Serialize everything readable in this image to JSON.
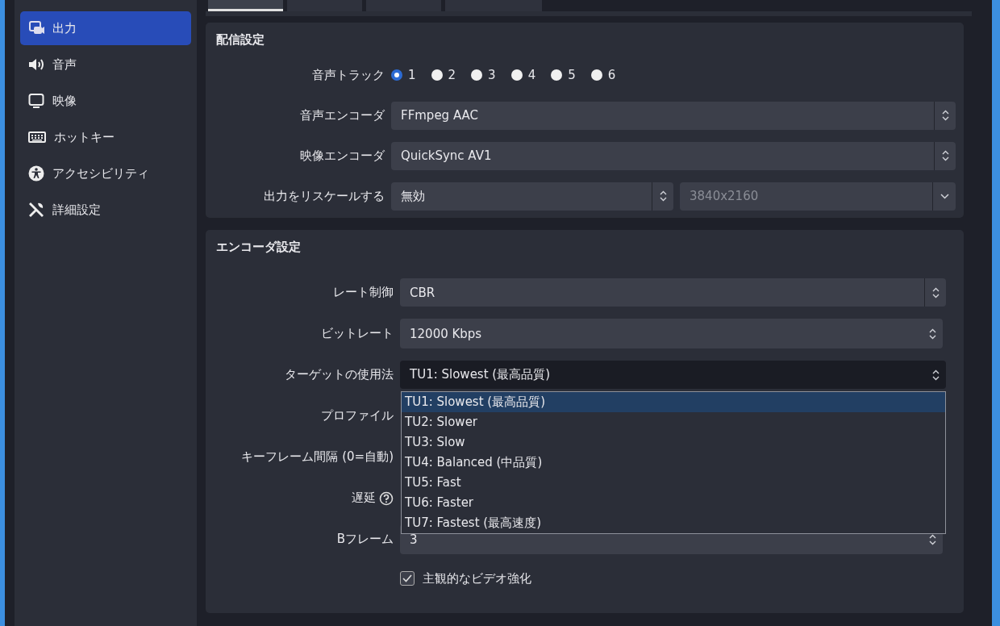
{
  "tabs": [
    {
      "selected": true
    },
    {
      "selected": false
    },
    {
      "selected": false
    },
    {
      "selected": false
    }
  ],
  "sidebar": {
    "items": [
      {
        "kind": "output",
        "label": "出力",
        "selected": true
      },
      {
        "kind": "audio",
        "label": "音声",
        "selected": false
      },
      {
        "kind": "video",
        "label": "映像",
        "selected": false
      },
      {
        "kind": "hotkeys",
        "label": "ホットキー",
        "selected": false
      },
      {
        "kind": "accessibility",
        "label": "アクセシビリティ",
        "selected": false
      },
      {
        "kind": "advanced",
        "label": "詳細設定",
        "selected": false
      }
    ]
  },
  "stream_settings": {
    "title": "配信設定",
    "audio_track": {
      "label": "音声トラック",
      "options": [
        {
          "label": "1",
          "selected": true
        },
        {
          "label": "2",
          "selected": false
        },
        {
          "label": "3",
          "selected": false
        },
        {
          "label": "4",
          "selected": false
        },
        {
          "label": "5",
          "selected": false
        },
        {
          "label": "6",
          "selected": false
        }
      ]
    },
    "audio_encoder": {
      "label": "音声エンコーダ",
      "value": "FFmpeg AAC"
    },
    "video_encoder": {
      "label": "映像エンコーダ",
      "value": "QuickSync AV1"
    },
    "rescale": {
      "label": "出力をリスケールする",
      "value": "無効",
      "resolution": {
        "value": "3840x2160",
        "disabled": true
      }
    }
  },
  "encoder_settings": {
    "title": "エンコーダ設定",
    "fields": [
      {
        "kind": "combo",
        "label": "レート制御",
        "value": "CBR"
      },
      {
        "kind": "spin",
        "label": "ビットレート",
        "value": "12000 Kbps"
      },
      {
        "kind": "combo",
        "label": "ターゲットの使用法",
        "value": "TU1: Slowest (最高品質)",
        "expanded": true,
        "options": [
          {
            "label": "TU1: Slowest (最高品質)",
            "selected": true
          },
          {
            "label": "TU2: Slower",
            "selected": false
          },
          {
            "label": "TU3: Slow",
            "selected": false
          },
          {
            "label": "TU4: Balanced (中品質)",
            "selected": false
          },
          {
            "label": "TU5: Fast",
            "selected": false
          },
          {
            "label": "TU6: Faster",
            "selected": false
          },
          {
            "label": "TU7: Fastest (最高速度)",
            "selected": false
          }
        ]
      },
      {
        "kind": "covered",
        "label": "プロファイル"
      },
      {
        "kind": "covered",
        "label": "キーフレーム間隔 (0=自動)"
      },
      {
        "kind": "covered",
        "label": "遅延",
        "help": true
      },
      {
        "kind": "spin",
        "label": "Bフレーム",
        "value": "3"
      }
    ],
    "checkbox": {
      "label": "主観的なビデオ強化",
      "checked": true
    }
  }
}
